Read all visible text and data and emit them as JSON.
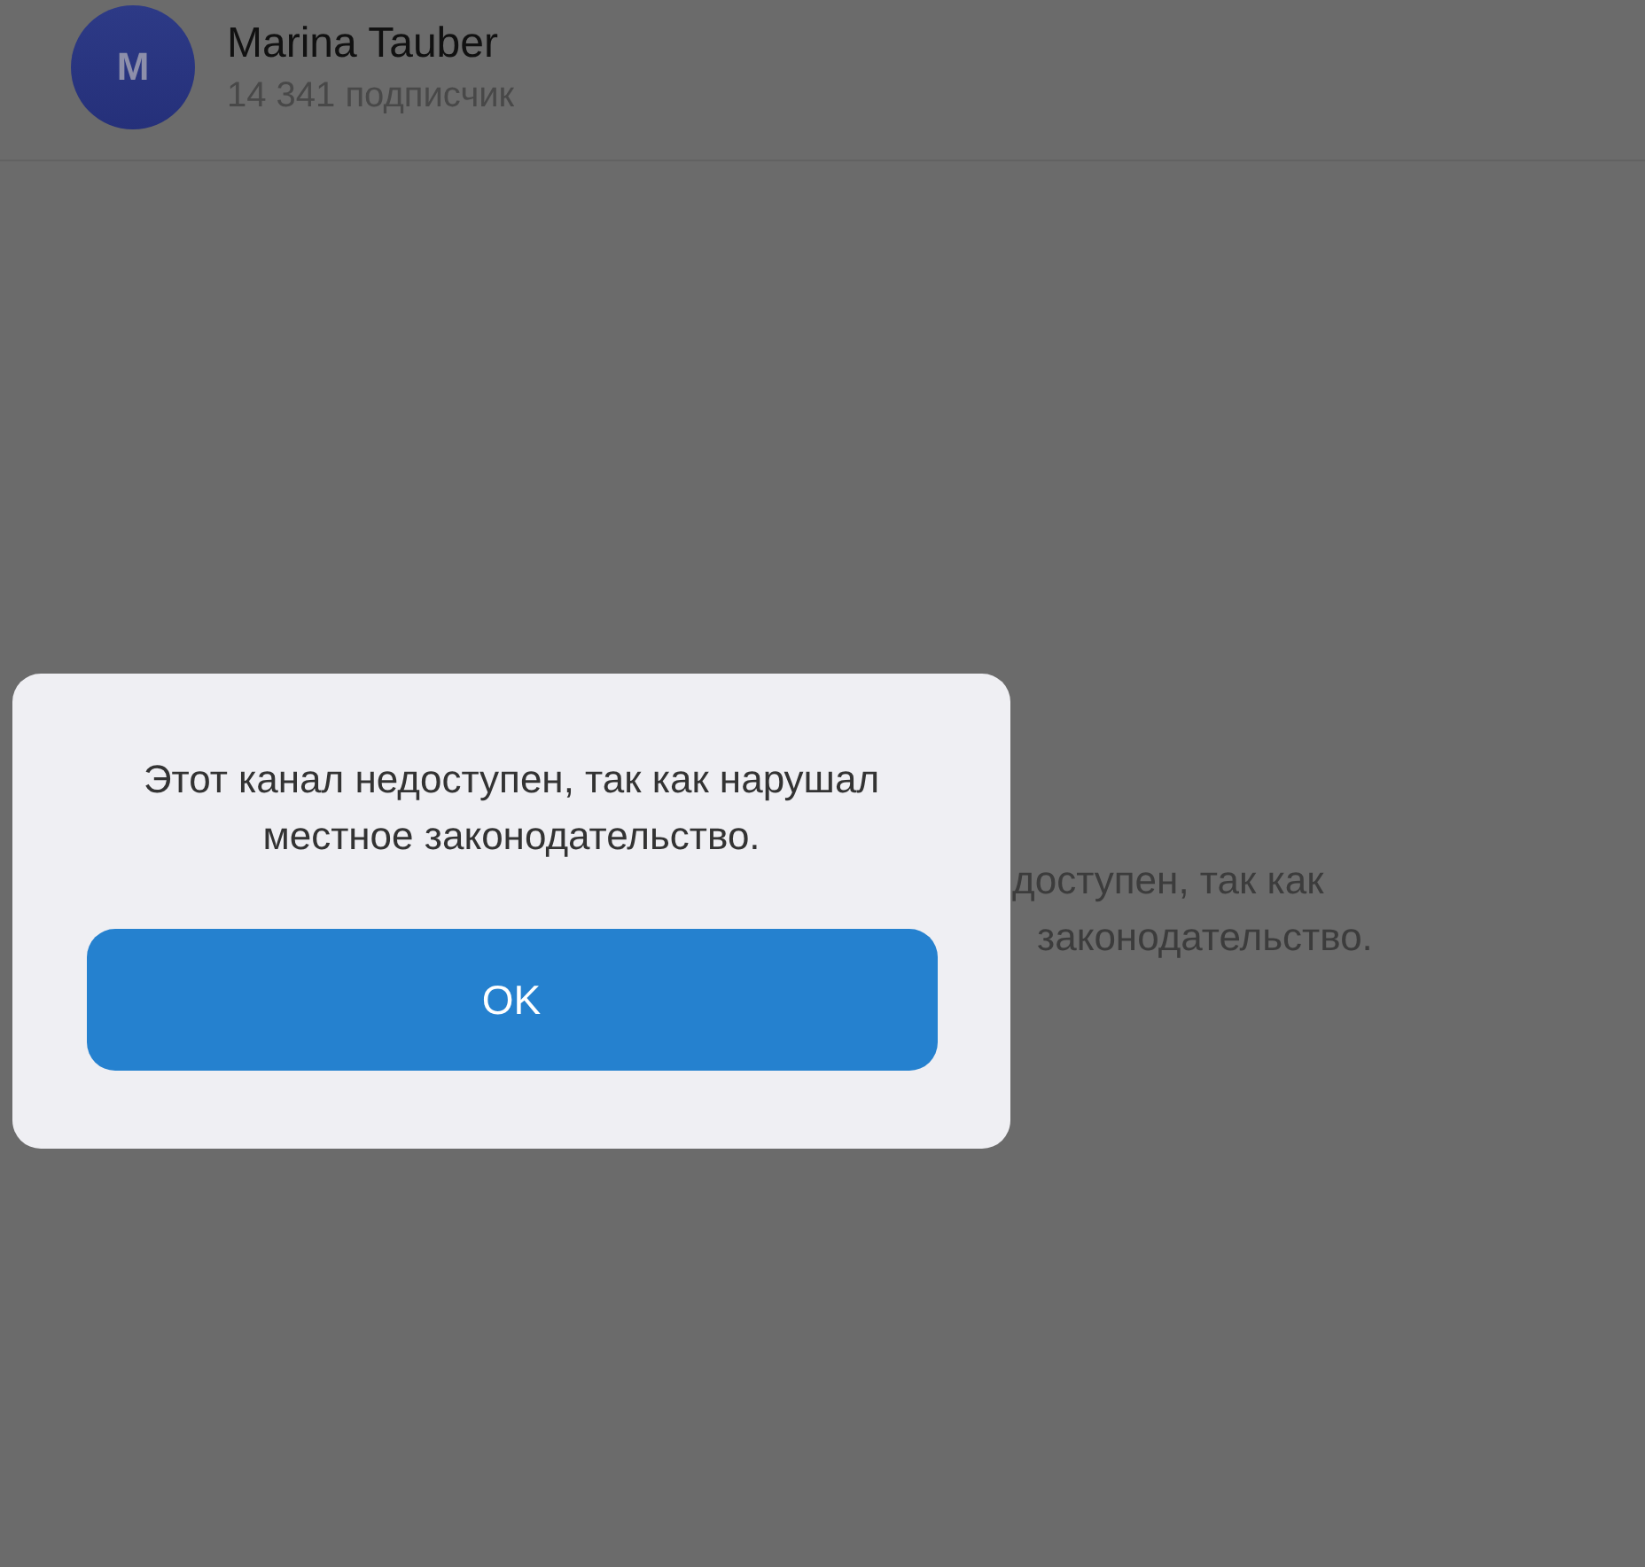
{
  "header": {
    "avatar_letter": "M",
    "name": "Marina Tauber",
    "subtitle": "14 341 подписчик"
  },
  "background_message": {
    "lines": [
      "доступен, так как",
      "законодательство."
    ]
  },
  "dialog": {
    "message": "Этот канал недоступен, так как нарушал местное законодательство.",
    "button": "OK"
  }
}
